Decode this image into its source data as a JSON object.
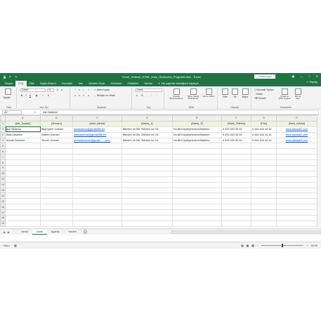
{
  "window": {
    "title": "Excel_Outlook_HTML_imza_Olusturma_Programi.xlsm  -  Excel",
    "signin": "Oturum açın",
    "quick_access": [
      "save-icon",
      "undo-icon",
      "redo-icon"
    ]
  },
  "ribbon_tabs": [
    "Dosya",
    "Giriş",
    "Ekle",
    "Sayfa Düzeni",
    "Formüller",
    "Veri",
    "Gözden Geçir",
    "Görünüm",
    "Geliştirici",
    "Yardım"
  ],
  "active_tab": "Giriş",
  "tell_me": "Ne yapmak istediğinizi söyleyin",
  "share": "Paylaş",
  "ribbon": {
    "paste": "Yapıştır",
    "font_name": "Calibri",
    "font_size": "11",
    "wrap_text": "Metni Kaydır",
    "merge_center": "Birleştir ve Ortala",
    "number_format": "Genel",
    "conditional_formatting": "Koşullu Biçimlendirme",
    "format_as_table": "Tablo Olarak Biçimlendir",
    "cell_styles": "Hücre Stilleri",
    "insert": "Ekle",
    "delete": "Sil",
    "format": "Biçim",
    "autosum": "Otomatik Toplam",
    "fill": "Doldur",
    "clear": "Temizle",
    "sort_filter": "Sırala ve Filtre Uygula",
    "find_select": "Bul ve Seç",
    "groups": {
      "clipboard": "Pano",
      "font": "Yazı Tipi",
      "alignment": "Hizalama",
      "number": "Sayı",
      "styles": "Stiller",
      "cells": "Hücreler",
      "editing": "Düzenleme"
    }
  },
  "formula_bar": {
    "name_box": "A2",
    "fx": "fx",
    "value": "Asri Akdeniz"
  },
  "grid": {
    "columns": [
      "A",
      "B",
      "C",
      "D",
      "E",
      "F",
      "G",
      "H"
    ],
    "header_row": [
      "[Adı_Soyadı]",
      "[Ünvanı]",
      "[Mail_Adresi]",
      "[Adres_1]",
      "[Adres_2]",
      "[Sabit_Telefon]",
      "[Fax]",
      "[Web_Adresi]"
    ],
    "rows": [
      [
        "Asri Akdeniz",
        "Bilgi İşlem Uzmanı",
        "asriakdeniz@gmailllllllll.trx",
        "Bilmem ne Mh. Bilmem ne Cd.",
        "No:88 Küçükçekmece/İstanbul",
        "0 333 333 33 33",
        "0 444 444 44 44",
        "www.alanadi1.com"
      ],
      [
        "Basri Akdeniz",
        "Sistem Uzmanı",
        "basriakdeniz@gmailllllllll.trx",
        "Bilmem ne Mh. Bilmem ne Cd.",
        "No:88 Küçükçekmece/İstanbul",
        "0 333 333 33 33",
        "0 444 444 44 44",
        "www.alanadi2.com"
      ],
      [
        "Ahmet Deneme",
        "Server Uzmanı",
        "ahmetdeneme@gmail.......cccc",
        "Bilmem ne Mh. Bilmem ne Cd.",
        "No:88 Küçükçekmece/İstanbul",
        "0 333 333 33 33",
        "0 444 444 44 44",
        "www.alanadi3.com"
      ]
    ],
    "row_numbers": [
      "1",
      "2",
      "3",
      "4",
      "5",
      "6",
      "7",
      "8",
      "9",
      "10",
      "11",
      "12",
      "13",
      "14",
      "15",
      "16",
      "17",
      "18",
      "19"
    ]
  },
  "sheet_tabs": [
    "Menü",
    "Liste",
    "Ayarlar",
    "Yardım"
  ],
  "active_sheet": "Liste",
  "status": {
    "ready": "Hazır",
    "zoom": "%100"
  },
  "colors": {
    "brand": "#217346",
    "header_fill": "#eef4e0",
    "link": "#1155cc"
  }
}
